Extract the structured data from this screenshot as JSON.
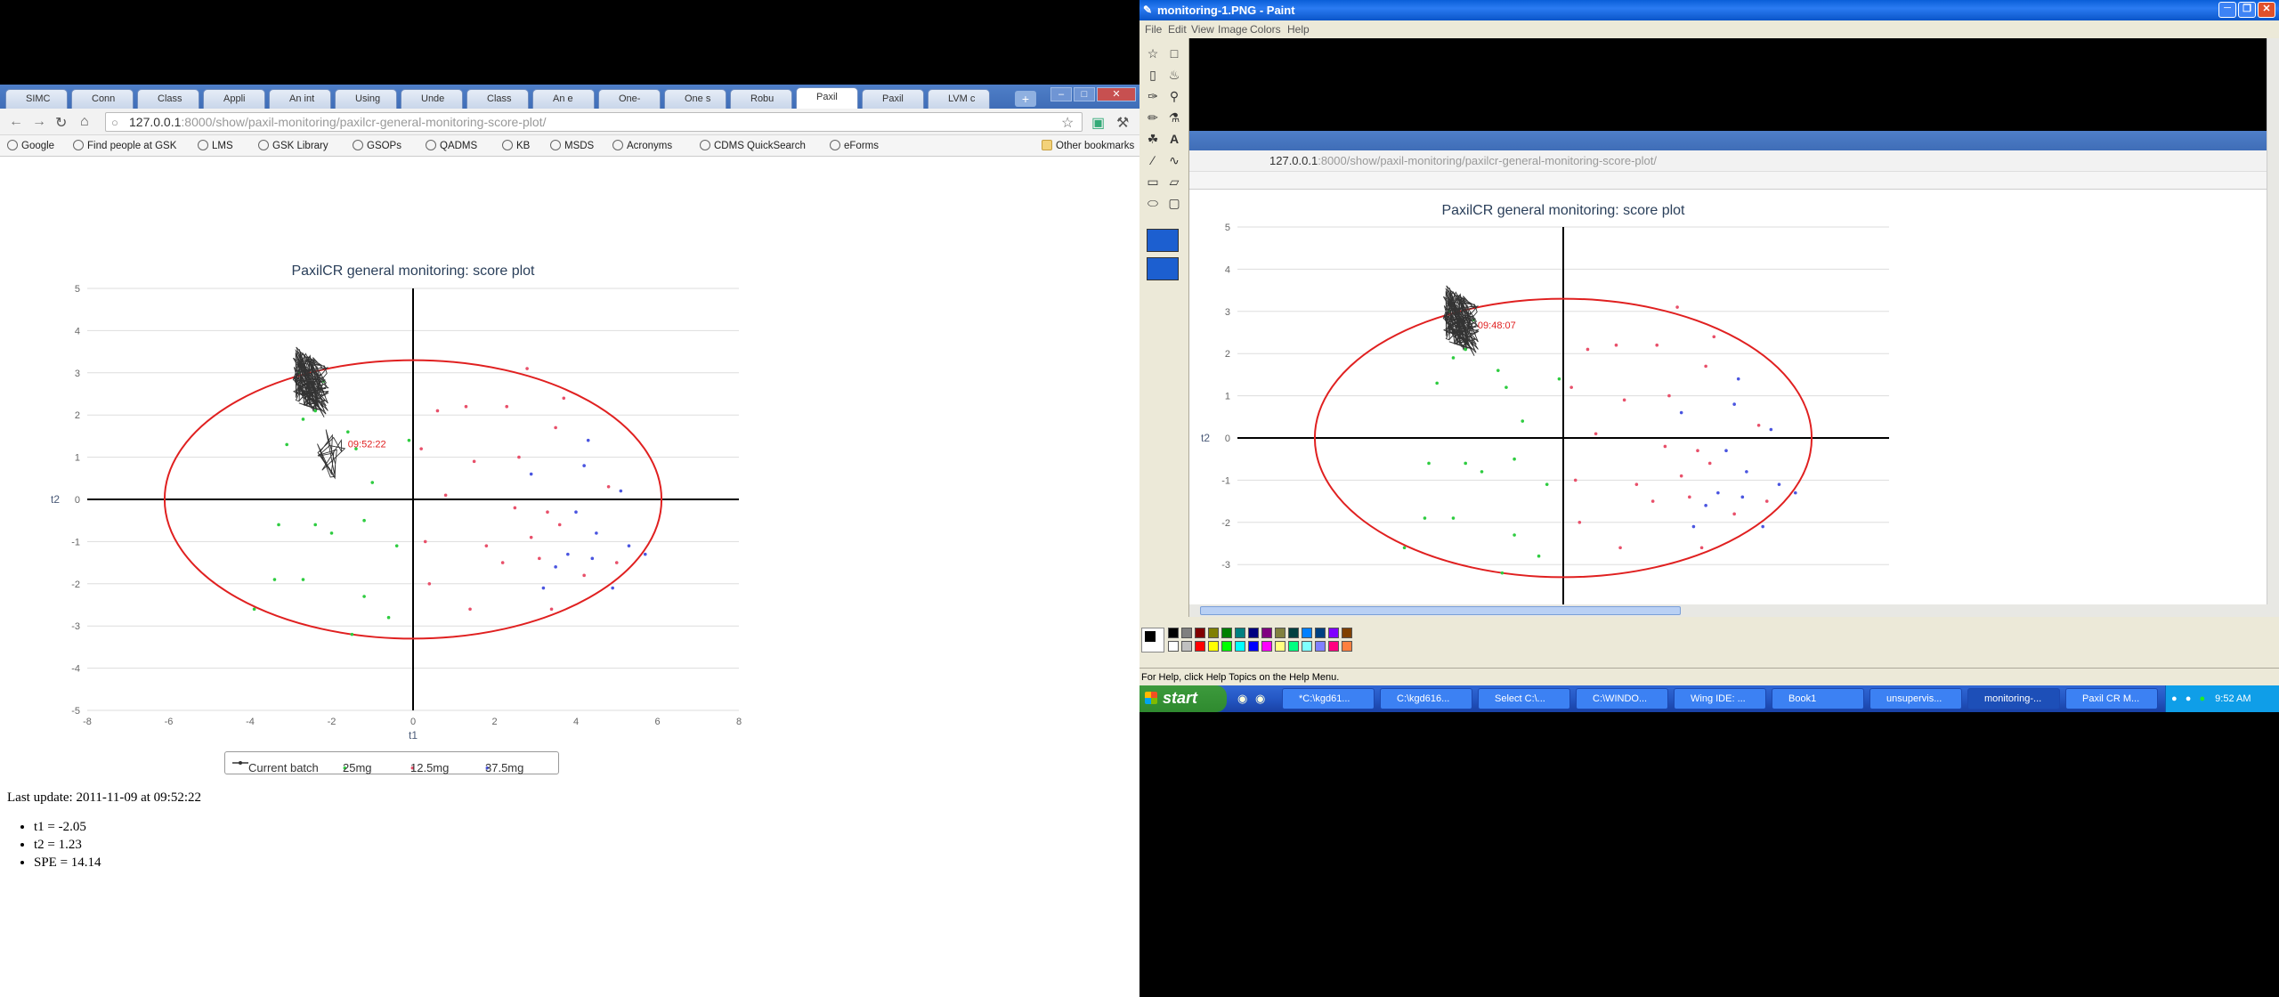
{
  "chrome": {
    "tabs": [
      "SIMC",
      "Conn",
      "Class",
      "Appli",
      "An int",
      "Using",
      "Unde",
      "Class",
      "An e",
      "One-",
      "One s",
      "Robu",
      "Paxil",
      "Paxil",
      "LVM c"
    ],
    "url_host": "127.0.0.1",
    "url_rest": ":8000/show/paxil-monitoring/paxilcr-general-monitoring-score-plot/",
    "bookmarks": [
      "Google",
      "Find people at GSK",
      "LMS",
      "GSK Library",
      "GSOPs",
      "QADMS",
      "KB",
      "MSDS",
      "Acronyms",
      "CDMS QuickSearch",
      "eForms"
    ],
    "other_bookmarks": "Other bookmarks",
    "new_tab_glyph": "+",
    "win_min": "–",
    "win_max": "□",
    "win_close": "✕"
  },
  "chart_data": {
    "type": "scatter",
    "title": "PaxilCR general monitoring: score plot",
    "xlabel": "t1",
    "ylabel": "t2",
    "xlim": [
      -8,
      8
    ],
    "ylim": [
      -5,
      5
    ],
    "x_ticks": [
      "-8",
      "-6",
      "-4",
      "-2",
      "0",
      "2",
      "4",
      "6",
      "8"
    ],
    "y_ticks": [
      "5",
      "4",
      "3",
      "2",
      "1",
      "0",
      "-1",
      "-2",
      "-3",
      "-4",
      "-5"
    ],
    "ellipse": {
      "center": [
        0,
        0
      ],
      "rx": 6.1,
      "ry": 3.3,
      "color": "#e02020"
    },
    "annotation": {
      "text": "09:52:22",
      "x": -1.6,
      "y": 1.23,
      "color": "#e02020"
    },
    "legend": [
      "Current batch",
      "25mg",
      "12.5mg",
      "37.5mg"
    ],
    "legend_position": "bottom",
    "series": [
      {
        "name": "25mg",
        "color": "#2ecc40",
        "points": [
          [
            -3.1,
            1.3
          ],
          [
            -2.7,
            1.9
          ],
          [
            -2.4,
            2.1
          ],
          [
            -1.6,
            1.6
          ],
          [
            -1.4,
            1.2
          ],
          [
            -1.0,
            0.4
          ],
          [
            -3.3,
            -0.6
          ],
          [
            -2.4,
            -0.6
          ],
          [
            -2.0,
            -0.8
          ],
          [
            -1.2,
            -0.5
          ],
          [
            -0.4,
            -1.1
          ],
          [
            -3.4,
            -1.9
          ],
          [
            -2.7,
            -1.9
          ],
          [
            -1.2,
            -2.3
          ],
          [
            -0.6,
            -2.8
          ],
          [
            -3.9,
            -2.6
          ],
          [
            -1.5,
            -3.2
          ],
          [
            -0.1,
            1.4
          ],
          [
            -2.2,
            2.8
          ],
          [
            -2.8,
            3.0
          ]
        ]
      },
      {
        "name": "12.5mg",
        "color": "#e8506a",
        "points": [
          [
            0.6,
            2.1
          ],
          [
            1.3,
            2.2
          ],
          [
            2.3,
            2.2
          ],
          [
            2.8,
            3.1
          ],
          [
            3.5,
            1.7
          ],
          [
            3.7,
            2.4
          ],
          [
            2.6,
            1.0
          ],
          [
            1.5,
            0.9
          ],
          [
            0.2,
            1.2
          ],
          [
            0.8,
            0.1
          ],
          [
            2.5,
            -0.2
          ],
          [
            3.3,
            -0.3
          ],
          [
            3.6,
            -0.6
          ],
          [
            2.9,
            -0.9
          ],
          [
            3.1,
            -1.4
          ],
          [
            2.2,
            -1.5
          ],
          [
            1.8,
            -1.1
          ],
          [
            0.3,
            -1.0
          ],
          [
            0.4,
            -2.0
          ],
          [
            4.2,
            -1.8
          ],
          [
            3.4,
            -2.6
          ],
          [
            1.4,
            -2.6
          ],
          [
            4.8,
            0.3
          ],
          [
            5.0,
            -1.5
          ]
        ]
      },
      {
        "name": "37.5mg",
        "color": "#4a55e0",
        "points": [
          [
            4.3,
            1.4
          ],
          [
            4.2,
            0.8
          ],
          [
            4.0,
            -0.3
          ],
          [
            4.5,
            -0.8
          ],
          [
            4.4,
            -1.4
          ],
          [
            3.5,
            -1.6
          ],
          [
            3.8,
            -1.3
          ],
          [
            5.3,
            -1.1
          ],
          [
            5.7,
            -1.3
          ],
          [
            3.2,
            -2.1
          ],
          [
            4.9,
            -2.1
          ],
          [
            2.9,
            0.6
          ],
          [
            5.1,
            0.2
          ]
        ]
      }
    ],
    "current_batch": {
      "name": "Current batch",
      "color": "#333333",
      "cluster_center": [
        -2.5,
        2.75
      ],
      "tail_center": [
        -2.0,
        1.05
      ]
    }
  },
  "status": {
    "last_update": "Last update: 2011-11-09 at 09:52:22",
    "values": [
      "t1 = -2.05",
      "t2 = 1.23",
      "SPE = 14.14"
    ]
  },
  "paint": {
    "title": "monitoring-1.PNG - Paint",
    "menu": [
      "File",
      "Edit",
      "View",
      "Image",
      "Colors",
      "Help"
    ],
    "status": "For Help, click Help Topics on the Help Menu.",
    "inner_annotation": "09:48:07",
    "palette_top": [
      "#000000",
      "#808080",
      "#800000",
      "#808000",
      "#008000",
      "#008080",
      "#000080",
      "#800080",
      "#808040",
      "#004040",
      "#0080ff",
      "#004080",
      "#8000ff",
      "#804000"
    ],
    "palette_bottom": [
      "#ffffff",
      "#c0c0c0",
      "#ff0000",
      "#ffff00",
      "#00ff00",
      "#00ffff",
      "#0000ff",
      "#ff00ff",
      "#ffff80",
      "#00ff80",
      "#80ffff",
      "#8080ff",
      "#ff0080",
      "#ff8040"
    ]
  },
  "taskbar": {
    "start": "start",
    "tasks": [
      "*C:\\kgd61...",
      "C:\\kgd616...",
      "Select C:\\...",
      "C:\\WINDO...",
      "Wing IDE: ...",
      "Book1",
      "unsupervis...",
      "monitoring-...",
      "Paxil CR M..."
    ],
    "clock": "9:52 AM"
  }
}
